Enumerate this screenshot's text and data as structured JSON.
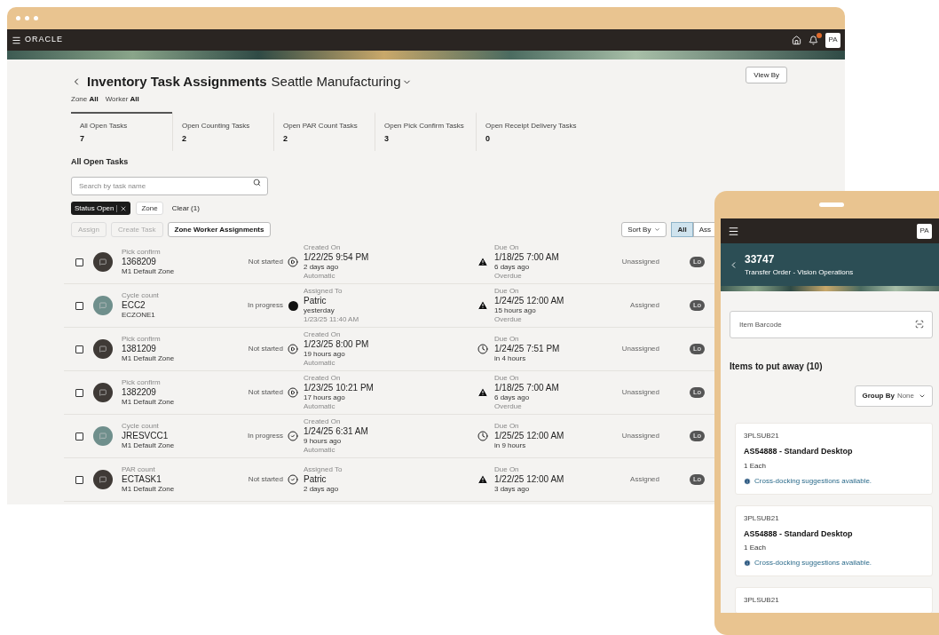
{
  "desktop": {
    "brand": "ORACLE",
    "avatar": "PA",
    "title": "Inventory Task Assignments",
    "subtitle": "Seattle Manufacturing",
    "filters": [
      {
        "label": "Zone",
        "value": "All"
      },
      {
        "label": "Worker",
        "value": "All"
      }
    ],
    "view_by": "View By",
    "tabs": [
      {
        "label": "All Open Tasks",
        "count": "7",
        "selected": true
      },
      {
        "label": "Open Counting Tasks",
        "count": "2",
        "selected": false
      },
      {
        "label": "Open PAR Count Tasks",
        "count": "2",
        "selected": false
      },
      {
        "label": "Open Pick Confirm Tasks",
        "count": "3",
        "selected": false
      },
      {
        "label": "Open Receipt Delivery Tasks",
        "count": "0",
        "selected": false
      }
    ],
    "section_title": "All Open Tasks",
    "search": {
      "placeholder": "Search by task name"
    },
    "chips": [
      {
        "kind": "active",
        "label": "Status Open"
      },
      {
        "kind": "plain",
        "label": "Zone"
      },
      {
        "kind": "link",
        "label": "Clear (1)"
      }
    ],
    "actions": [
      {
        "label": "Assign",
        "disabled": true
      },
      {
        "label": "Create Task",
        "disabled": true
      },
      {
        "label": "Zone Worker Assignments",
        "disabled": false
      }
    ],
    "sort": "Sort By",
    "segments": [
      {
        "label": "All",
        "selected": true
      },
      {
        "label": "Ass",
        "selected": false
      }
    ],
    "rows": [
      {
        "checked": false,
        "color": "#3f3a36",
        "type": "Pick confirm",
        "code": "1368209",
        "zone": "M1 Default Zone",
        "status": {
          "kind": "play",
          "text": "Not started"
        },
        "created": {
          "label": "Created On",
          "value": "1/22/25 9:54 PM",
          "ago": "2 days ago",
          "note": "Automatic"
        },
        "due": {
          "kind": "warning",
          "label": "Due On",
          "value": "1/18/25 7:00 AM",
          "ago": "6 days ago",
          "note": "Overdue"
        },
        "assignment": "Unassigned",
        "badge": "Lo"
      },
      {
        "checked": false,
        "color": "#6f8f8c",
        "type": "Cycle count",
        "code": "ECC2",
        "zone": "ECZONE1",
        "status": {
          "kind": "dot",
          "text": "In progress"
        },
        "created": {
          "label": "Assigned To",
          "value": "Patric",
          "ago": "yesterday",
          "note": "1/23/25 11:40 AM"
        },
        "due": {
          "kind": "warning",
          "label": "Due On",
          "value": "1/24/25 12:00 AM",
          "ago": "15 hours ago",
          "note": "Overdue"
        },
        "assignment": "Assigned",
        "badge": "Lo"
      },
      {
        "checked": false,
        "color": "#3f3a36",
        "type": "Pick confirm",
        "code": "1381209",
        "zone": "M1 Default Zone",
        "status": {
          "kind": "play",
          "text": "Not started"
        },
        "created": {
          "label": "Created On",
          "value": "1/23/25 8:00 PM",
          "ago": "19 hours ago",
          "note": "Automatic"
        },
        "due": {
          "kind": "clock",
          "label": "Due On",
          "value": "1/24/25 7:51 PM",
          "ago": "in 4 hours"
        },
        "assignment": "Unassigned",
        "badge": "Lo"
      },
      {
        "checked": false,
        "color": "#3f3a36",
        "type": "Pick confirm",
        "code": "1382209",
        "zone": "M1 Default Zone",
        "status": {
          "kind": "play",
          "text": "Not started"
        },
        "created": {
          "label": "Created On",
          "value": "1/23/25 10:21 PM",
          "ago": "17 hours ago",
          "note": "Automatic"
        },
        "due": {
          "kind": "warning",
          "label": "Due On",
          "value": "1/18/25 7:00 AM",
          "ago": "6 days ago",
          "note": "Overdue"
        },
        "assignment": "Unassigned",
        "badge": "Lo"
      },
      {
        "checked": false,
        "color": "#6f8f8c",
        "type": "Cycle count",
        "code": "JRESVCC1",
        "zone": "M1 Default Zone",
        "status": {
          "kind": "check",
          "text": "In progress"
        },
        "created": {
          "label": "Created On",
          "value": "1/24/25 6:31 AM",
          "ago": "9 hours ago",
          "note": "Automatic"
        },
        "due": {
          "kind": "clock",
          "label": "Due On",
          "value": "1/25/25 12:00 AM",
          "ago": "in 9 hours"
        },
        "assignment": "Unassigned",
        "badge": "Lo"
      },
      {
        "checked": false,
        "color": "#3f3a36",
        "type": "PAR count",
        "code": "ECTASK1",
        "zone": "M1 Default Zone",
        "status": {
          "kind": "check",
          "text": "Not started"
        },
        "created": {
          "label": "Assigned To",
          "value": "Patric",
          "ago": "2 days ago"
        },
        "due": {
          "kind": "warning",
          "label": "Due On",
          "value": "1/22/25 12:00 AM",
          "ago": "3 days ago"
        },
        "assignment": "Assigned",
        "badge": "Lo"
      }
    ]
  },
  "mobile": {
    "avatar": "PA",
    "title": "33747",
    "subtitle": "Transfer Order - Vision Operations",
    "barcode": {
      "placeholder": "Item Barcode"
    },
    "section_title": "Items to put away (10)",
    "group_by": {
      "label": "Group By",
      "value": "None"
    },
    "items": [
      {
        "code": "3PLSUB21",
        "name": "AS54888 - Standard Desktop",
        "qty": "1 Each",
        "note": "Cross-docking suggestions available."
      },
      {
        "code": "3PLSUB21",
        "name": "AS54888 - Standard Desktop",
        "qty": "1 Each",
        "note": "Cross-docking suggestions available."
      },
      {
        "code": "3PLSUB21"
      }
    ]
  }
}
